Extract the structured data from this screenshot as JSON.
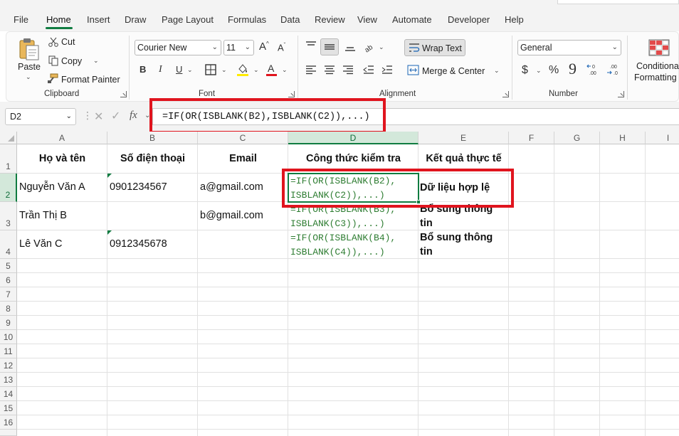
{
  "menu": {
    "items": [
      "File",
      "Home",
      "Insert",
      "Draw",
      "Page Layout",
      "Formulas",
      "Data",
      "Review",
      "View",
      "Automate",
      "Developer",
      "Help"
    ],
    "active": "Home"
  },
  "ribbon": {
    "clipboard": {
      "paste": "Paste",
      "cut": "Cut",
      "copy": "Copy",
      "format_painter": "Format Painter",
      "label": "Clipboard"
    },
    "font": {
      "font_name": "Courier New",
      "font_size": "11",
      "grow": "A",
      "shrink": "A",
      "bold": "B",
      "italic": "I",
      "underline": "U",
      "font_color_letter": "A",
      "label": "Font"
    },
    "alignment": {
      "wrap_text": "Wrap Text",
      "merge_center": "Merge & Center",
      "label": "Alignment"
    },
    "number": {
      "format": "General",
      "currency": "$",
      "percent": "%",
      "comma": "9",
      "label": "Number"
    },
    "styles": {
      "conditional_line1": "Conditional",
      "conditional_line2": "Formatting"
    }
  },
  "formula_bar": {
    "name_box": "D2",
    "fx": "fx",
    "formula": "=IF(OR(ISBLANK(B2),ISBLANK(C2)),...)"
  },
  "columns": [
    "A",
    "B",
    "C",
    "D",
    "E",
    "F",
    "G",
    "H",
    "I"
  ],
  "rows": [
    "1",
    "2",
    "3",
    "4",
    "5",
    "6",
    "7",
    "8",
    "9",
    "10",
    "11",
    "12",
    "13",
    "14",
    "15",
    "16"
  ],
  "sheet": {
    "headers": [
      "Họ và tên",
      "Số điện thoại",
      "Email",
      "Công thức kiểm tra",
      "Kết quả thực tế"
    ],
    "data": [
      {
        "name": "Nguyễn Văn A",
        "phone": "0901234567",
        "email": "a@gmail.com",
        "formula_line1": "=IF(OR(ISBLANK(B2),",
        "formula_line2": "ISBLANK(C2)),...)",
        "result": "Dữ liệu hợp lệ"
      },
      {
        "name": "Trần Thị B",
        "phone": "",
        "email": "b@gmail.com",
        "formula_line1": "=IF(OR(ISBLANK(B3),",
        "formula_line2": "ISBLANK(C3)),...)",
        "result": "Bổ sung thông tin"
      },
      {
        "name": "Lê Văn C",
        "phone": "0912345678",
        "email": "",
        "formula_line1": "=IF(OR(ISBLANK(B4),",
        "formula_line2": "ISBLANK(C4)),...)",
        "result": "Bổ sung thông tin"
      }
    ]
  },
  "colors": {
    "accent": "#107c41",
    "highlight_box": "#e0141e",
    "formula_text": "#2e7d32"
  }
}
